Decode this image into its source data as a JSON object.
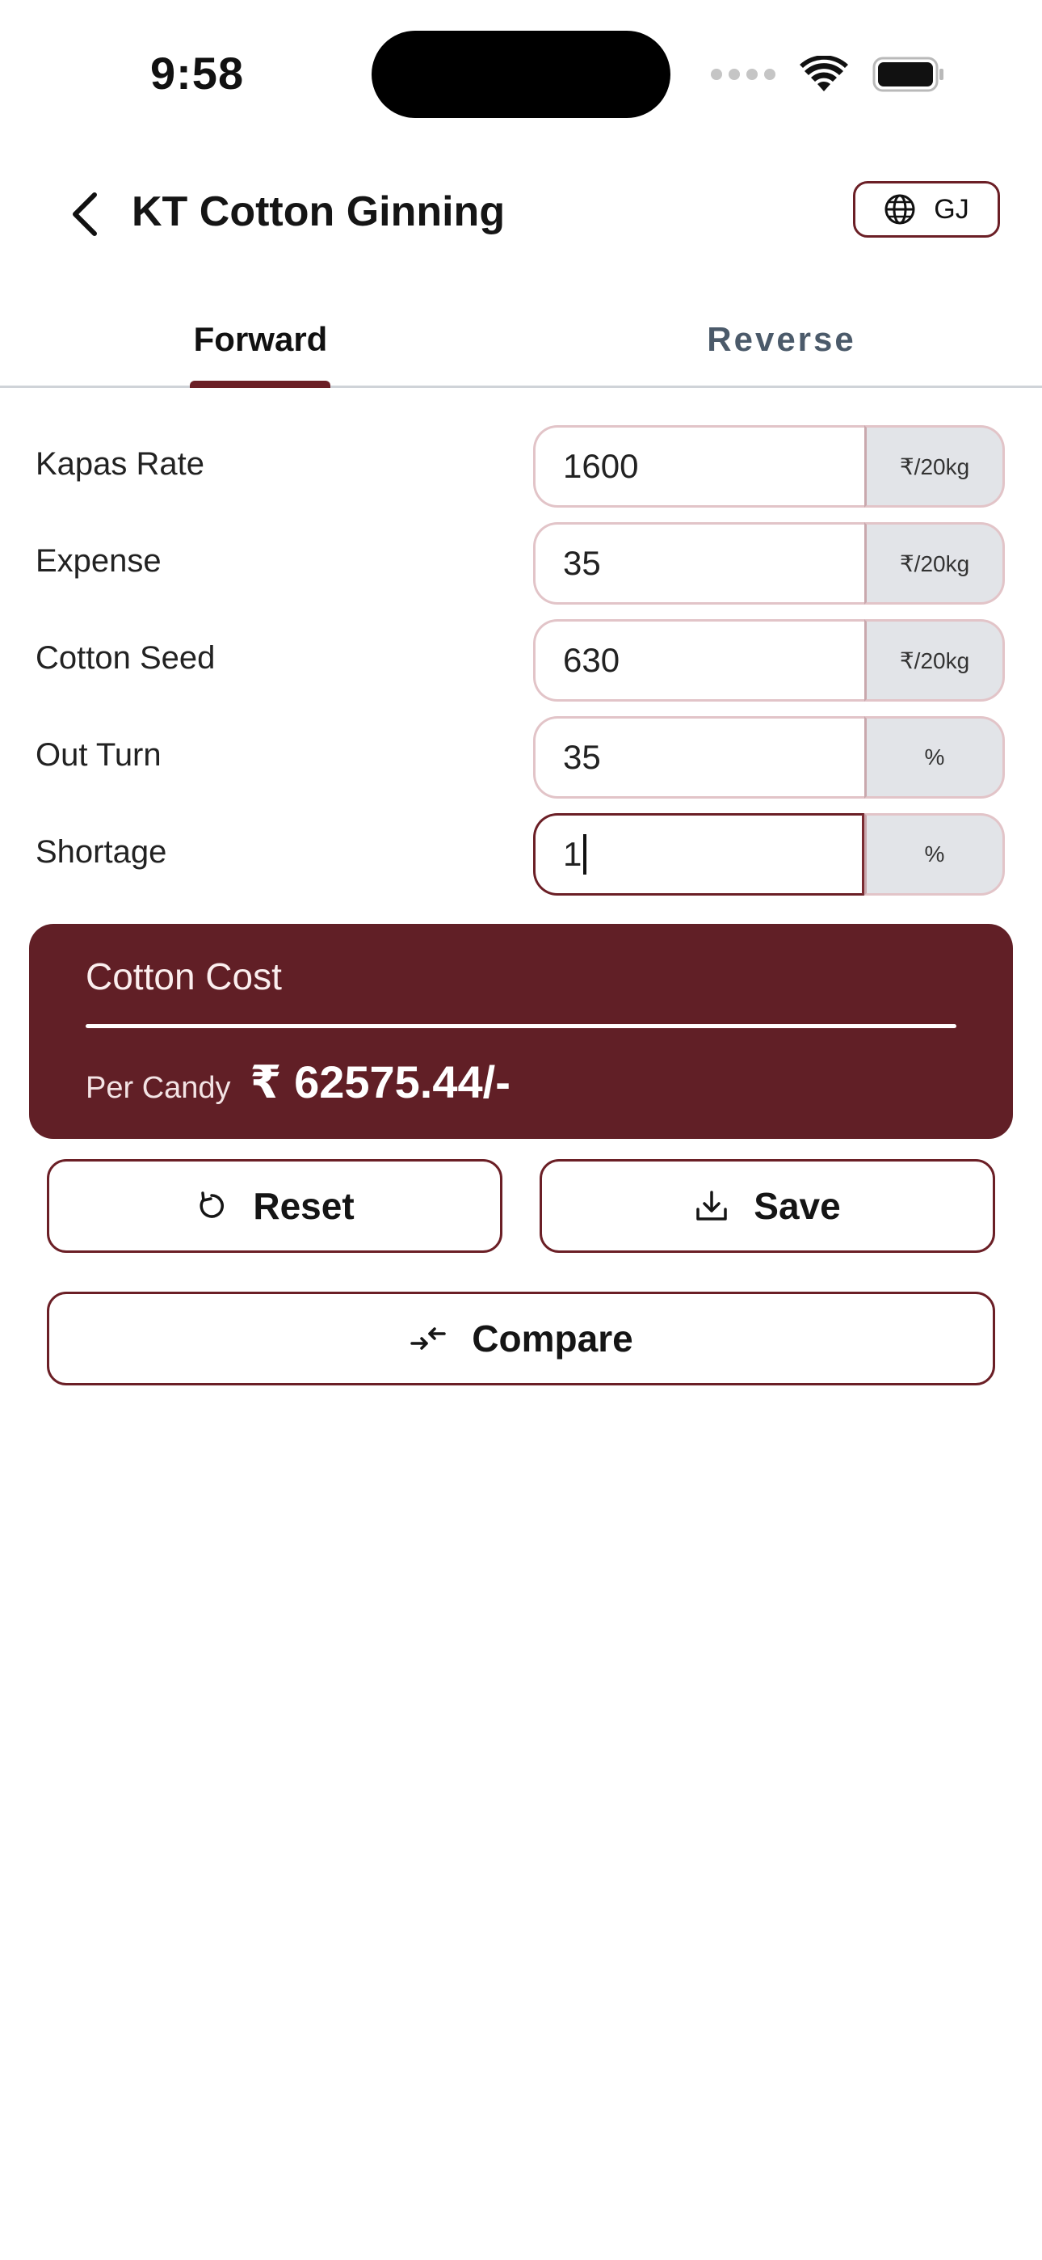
{
  "status_bar": {
    "time": "9:58"
  },
  "header": {
    "title": "KT Cotton Ginning",
    "back_icon": "chevron-left-icon",
    "language_icon": "globe-icon",
    "language_label": "GJ"
  },
  "tabs": [
    {
      "label": "Forward",
      "active": true
    },
    {
      "label": "Reverse",
      "active": false
    }
  ],
  "form": {
    "rows": [
      {
        "label": "Kapas Rate",
        "value": "1600",
        "unit": "₹/20kg"
      },
      {
        "label": "Expense",
        "value": "35",
        "unit": "₹/20kg"
      },
      {
        "label": "Cotton Seed",
        "value": "630",
        "unit": "₹/20kg"
      },
      {
        "label": "Out Turn",
        "value": "35",
        "unit": "%"
      },
      {
        "label": "Shortage",
        "value": "1",
        "unit": "%",
        "focused": true
      }
    ]
  },
  "result": {
    "title": "Cotton Cost",
    "label": "Per Candy",
    "value": "₹ 62575.44/-"
  },
  "buttons": {
    "reset_label": "Reset",
    "save_label": "Save",
    "compare_label": "Compare"
  },
  "colors": {
    "accent": "#6b1f26",
    "card": "#611f26",
    "unit_bg": "#e2e4e8",
    "tab_inactive": "#4b5a6a"
  }
}
